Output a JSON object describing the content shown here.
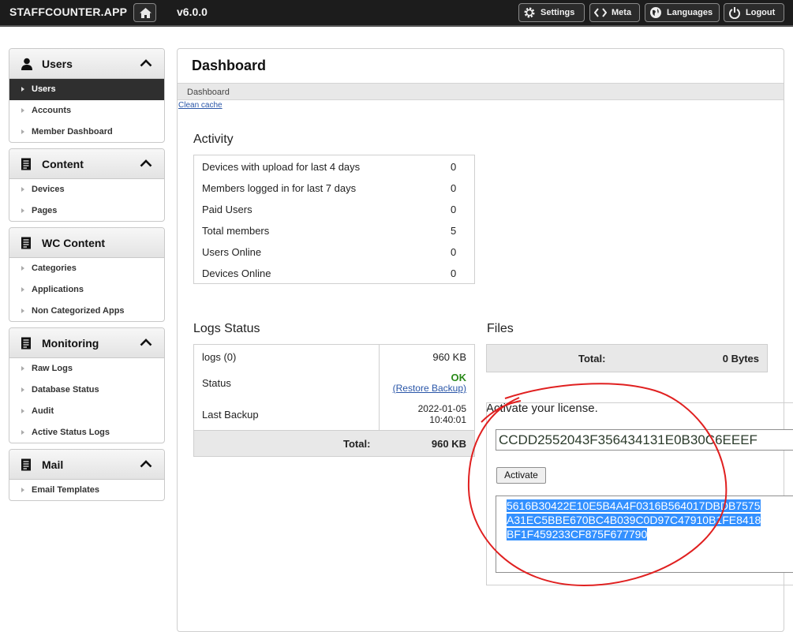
{
  "topbar": {
    "brand": "STAFFCOUNTER.APP",
    "version": "v6.0.0",
    "buttons": [
      {
        "label": "Settings",
        "icon": "gear-icon"
      },
      {
        "label": "Meta",
        "icon": "code-icon"
      },
      {
        "label": "Languages",
        "icon": "globe-icon"
      },
      {
        "label": "Logout",
        "icon": "power-icon"
      }
    ]
  },
  "sidebar": {
    "panels": [
      {
        "title": "Users",
        "icon": "user-icon",
        "items": [
          "Users",
          "Accounts",
          "Member Dashboard"
        ],
        "active": "Users"
      },
      {
        "title": "Content",
        "icon": "document-icon",
        "items": [
          "Devices",
          "Pages"
        ]
      },
      {
        "title": "WC Content",
        "icon": "document-icon",
        "items": [
          "Categories",
          "Applications",
          "Non Categorized Apps"
        ]
      },
      {
        "title": "Monitoring",
        "icon": "document-icon",
        "items": [
          "Raw Logs",
          "Database Status",
          "Audit",
          "Active Status Logs"
        ]
      },
      {
        "title": "Mail",
        "icon": "document-icon",
        "items": [
          "Email Templates"
        ]
      }
    ]
  },
  "main": {
    "title": "Dashboard",
    "breadcrumb": "Dashboard",
    "clean_cache": "Clean cache",
    "activity": {
      "title": "Activity",
      "rows": [
        {
          "label": "Devices with upload for last 4 days",
          "value": "0"
        },
        {
          "label": "Members logged in for last 7 days",
          "value": "0"
        },
        {
          "label": "Paid Users",
          "value": "0"
        },
        {
          "label": "Total members",
          "value": "5"
        },
        {
          "label": "Users Online",
          "value": "0"
        },
        {
          "label": "Devices Online",
          "value": "0"
        }
      ]
    },
    "logs": {
      "title": "Logs Status",
      "logs_label": "logs (0)",
      "logs_size": "960 KB",
      "status_label": "Status",
      "status_ok": "OK",
      "restore_link": "(Restore Backup)",
      "last_backup_label": "Last Backup",
      "last_backup_date": "2022-01-05",
      "last_backup_time": "10:40:01",
      "total_label": "Total:",
      "total_value": "960 KB"
    },
    "files": {
      "title": "Files",
      "total_label": "Total:",
      "total_value": "0 Bytes"
    },
    "license": {
      "title": "Activate your license.",
      "key_value": "CCDD2552043F356434131E0B30C6EEEF",
      "button_label": "Activate",
      "response_lines": [
        "5616B30422E10E5B4A4F0316B564017DBDB7575",
        "A31EC5BBE670BC4B039C0D97C47910B1FE8418",
        "BF1F459233CF875F677790"
      ]
    }
  },
  "colors": {
    "topbar_bg": "#1c1c1c",
    "status_ok": "#2a8a1a",
    "link": "#2a56a8",
    "selection": "#3390ff",
    "annotation": "#e02020"
  }
}
